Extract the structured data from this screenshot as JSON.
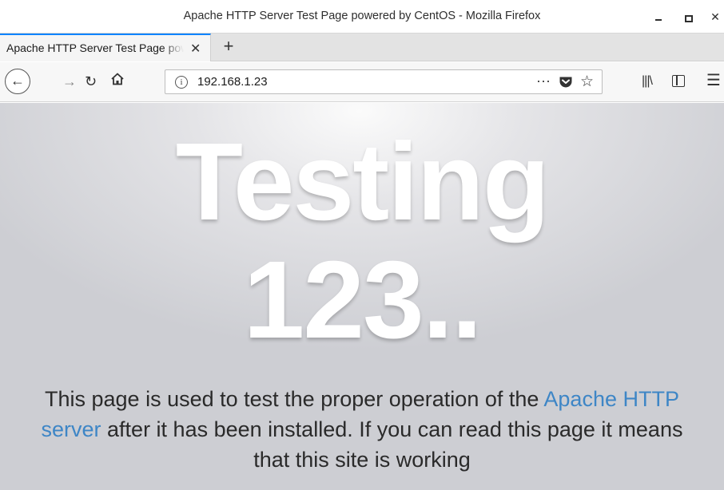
{
  "window": {
    "title": "Apache HTTP Server Test Page powered by CentOS - Mozilla Firefox"
  },
  "tabs": [
    {
      "label": "Apache HTTP Server Test Page powered by CentOS",
      "active": true
    }
  ],
  "navbar": {
    "url": "192.168.1.23"
  },
  "page": {
    "heading_line1": "Testing",
    "heading_line2": "123..",
    "text_before_link": "This page is used to test the proper operation of the ",
    "link_text": "Apache HTTP server",
    "text_after_link": " after it has been installed. If you can read this page it means that this site is working"
  },
  "colors": {
    "link": "#3e86c6",
    "tab_accent": "#0a84ff"
  },
  "icons": {
    "back": "arrow-left-icon",
    "forward": "arrow-right-icon",
    "reload": "reload-icon",
    "home": "home-icon",
    "info": "info-icon",
    "more": "page-actions-icon",
    "pocket": "pocket-icon",
    "bookmark": "star-icon",
    "library": "library-icon",
    "sidebar": "sidebar-icon",
    "menu": "hamburger-menu-icon"
  }
}
